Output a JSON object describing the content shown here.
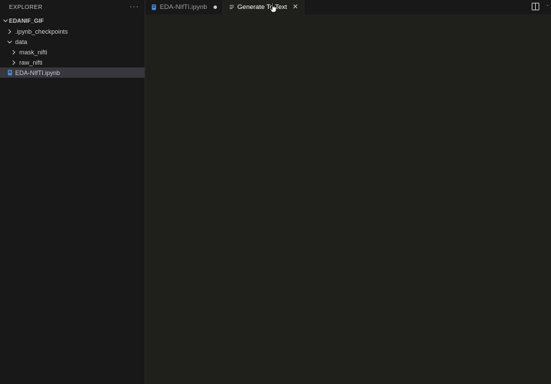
{
  "explorer": {
    "title": "EXPLORER",
    "more_icon": "ellipsis-icon",
    "folder": {
      "name": "EDANIF_GIF",
      "expanded": true
    },
    "items": [
      {
        "label": ".ipynb_checkpoints",
        "type": "folder",
        "expanded": false,
        "depth": 1
      },
      {
        "label": "data",
        "type": "folder",
        "expanded": true,
        "depth": 1
      },
      {
        "label": "mask_nifti",
        "type": "folder",
        "expanded": false,
        "depth": 2
      },
      {
        "label": "raw_nifti",
        "type": "folder",
        "expanded": false,
        "depth": 2
      },
      {
        "label": "EDA-NIfTI.ipynb",
        "type": "notebook",
        "depth": 1,
        "selected": true
      }
    ]
  },
  "tabs": [
    {
      "label": "EDA-NIfTI.ipynb",
      "icon": "notebook-icon",
      "dirty": true,
      "active": false
    },
    {
      "label": "Generate To Text",
      "icon": "lines-icon",
      "dirty": false,
      "active": true
    }
  ],
  "colors": {
    "sidebar_bg": "#181818",
    "editor_bg": "#1f1f1c",
    "selection_bg": "#37373d",
    "notebook_icon": "#4d8fd6"
  }
}
